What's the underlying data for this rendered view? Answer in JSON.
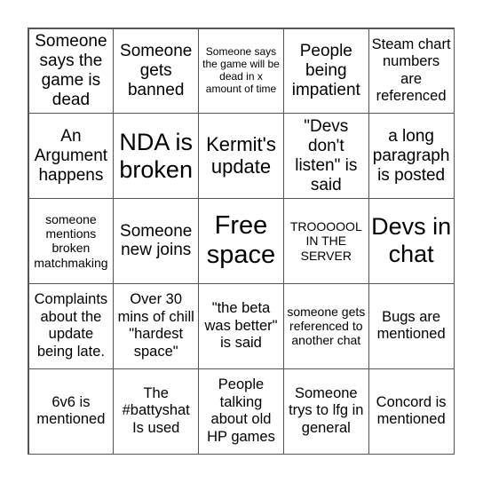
{
  "card": {
    "cells": [
      {
        "text": "Someone says the game is dead"
      },
      {
        "text": "Someone gets banned"
      },
      {
        "text": "Someone says the game will be dead in x amount of time"
      },
      {
        "text": "People being impatient"
      },
      {
        "text": "Steam chart numbers are referenced"
      },
      {
        "text": "An Argument happens"
      },
      {
        "text": "NDA is broken"
      },
      {
        "text": "Kermit's update"
      },
      {
        "text": "\"Devs don't listen\" is said"
      },
      {
        "text": "a long paragraph is posted"
      },
      {
        "text": "someone mentions broken matchmaking"
      },
      {
        "text": "Someone new joins"
      },
      {
        "text": "Free space"
      },
      {
        "text": "TROOOOOL IN THE SERVER"
      },
      {
        "text": "Devs in chat"
      },
      {
        "text": "Complaints about the update being late."
      },
      {
        "text": "Over 30 mins of chill \"hardest space\""
      },
      {
        "text": "\"the beta was better\" is said"
      },
      {
        "text": "someone gets referenced to another chat"
      },
      {
        "text": "Bugs are mentioned"
      },
      {
        "text": "6v6 is mentioned"
      },
      {
        "text": "The #battyshat Is used"
      },
      {
        "text": "People talking about old HP games"
      },
      {
        "text": "Someone trys to lfg in general"
      },
      {
        "text": "Concord is mentioned"
      }
    ]
  },
  "colors": {
    "grid_line": "#555555",
    "text": "#000000",
    "background": "#ffffff"
  }
}
